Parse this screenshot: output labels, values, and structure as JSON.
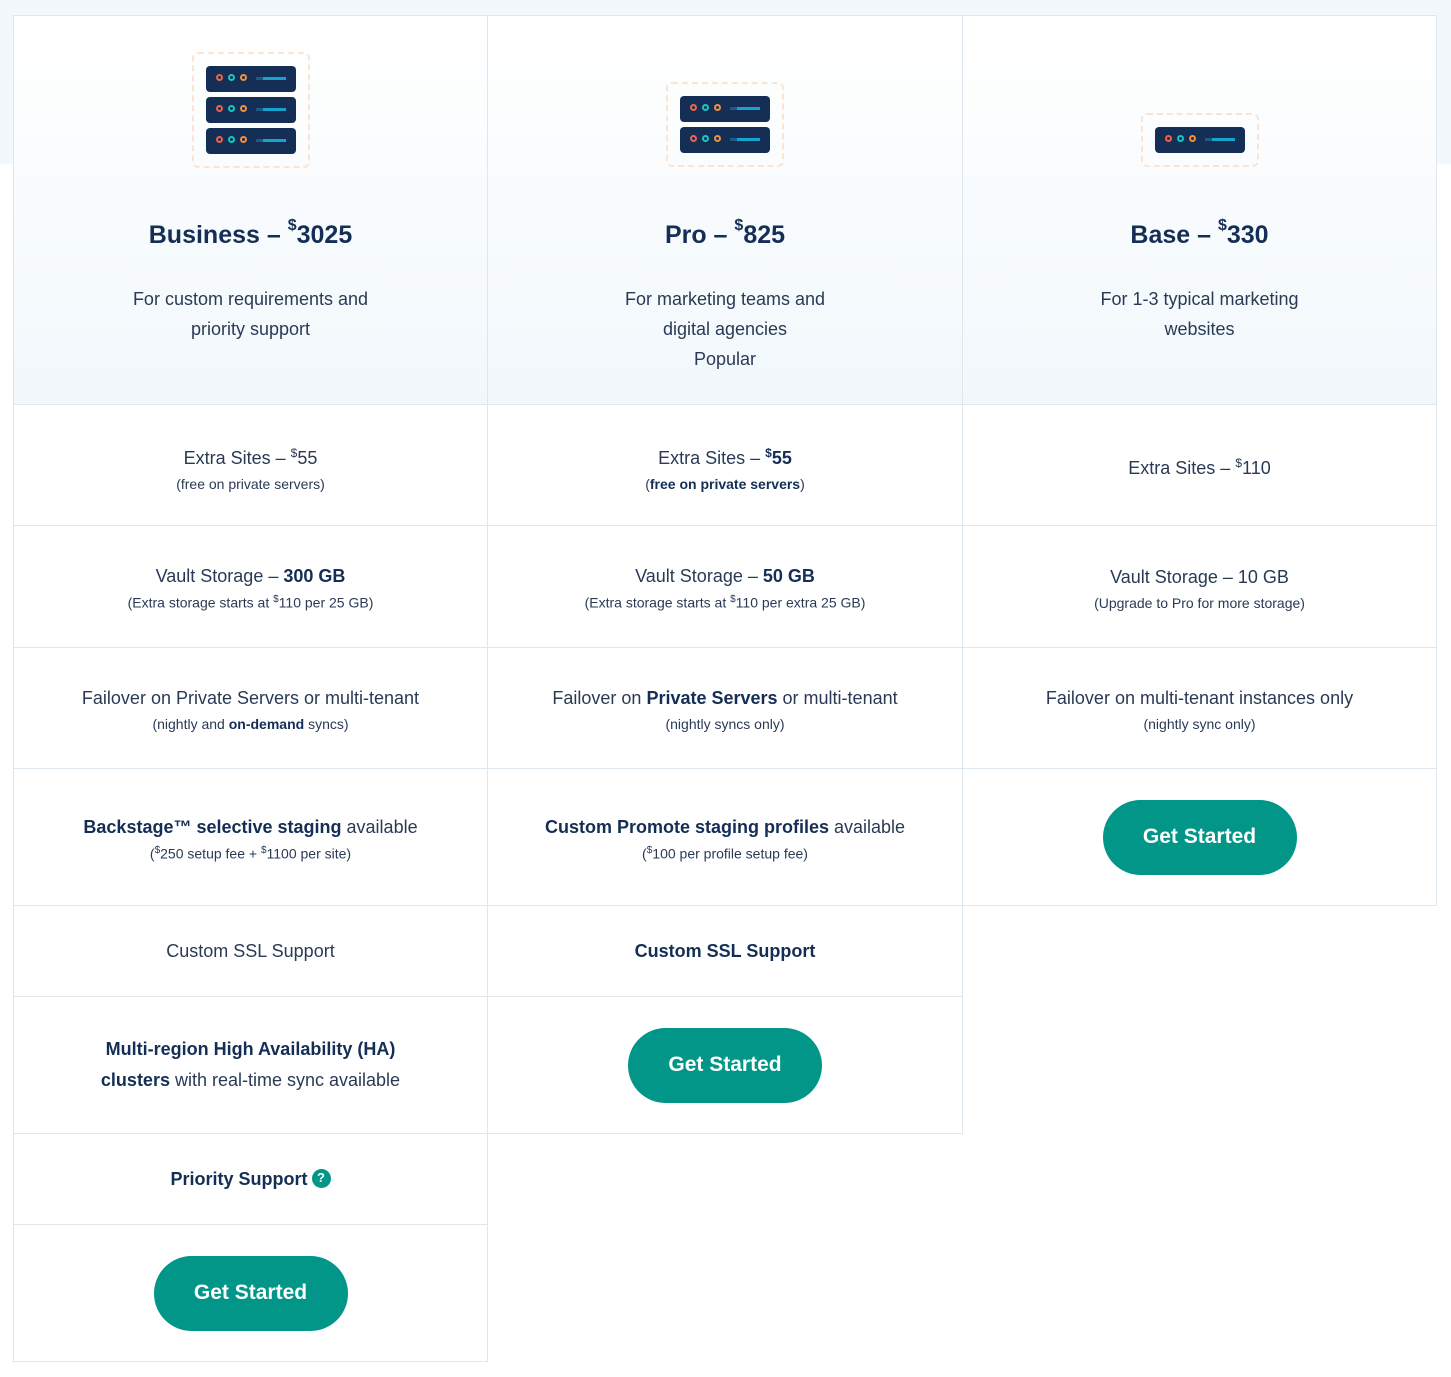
{
  "colors": {
    "accent": "#019688",
    "navy": "#142e55",
    "border": "#dfe7ee",
    "band": "#f2f8fc"
  },
  "plans": {
    "business": {
      "name": "Business –",
      "currency": "$",
      "price": "3025",
      "desc1": "For custom requirements and",
      "desc2": "priority support",
      "extra_sites_label": "Extra Sites – ",
      "extra_sites_price": "55",
      "extra_sites_note": "(free on private servers)",
      "vault_label": "Vault Storage – ",
      "vault_value": "300 GB",
      "vault_note_a": "(Extra storage starts at ",
      "vault_note_price": "110",
      "vault_note_b": " per 25 GB)",
      "failover": "Failover on Private Servers or multi-tenant",
      "failover_note_a": "(nightly and ",
      "failover_note_bold": "on-demand",
      "failover_note_b": " syncs)",
      "staging_bold": "Backstage™ selective staging",
      "staging_rest": " available",
      "staging_note_a": "(",
      "staging_note_p1": "250",
      "staging_note_b": " setup fee + ",
      "staging_note_p2": "1100",
      "staging_note_c": " per site)",
      "ssl": "Custom SSL Support",
      "ha_bold1": "Multi-region High Availability (HA)",
      "ha_bold2": "clusters",
      "ha_rest": " with real-time sync available",
      "priority": "Priority Support",
      "priority_icon": "question-circle-icon",
      "cta": "Get Started"
    },
    "pro": {
      "name": "Pro –",
      "currency": "$",
      "price": "825",
      "desc1": "For marketing teams and",
      "desc2": "digital agencies",
      "badge": "Popular",
      "extra_sites_label": "Extra Sites – ",
      "extra_sites_price": "55",
      "extra_sites_note_bold": "free on private servers",
      "vault_label": "Vault Storage – ",
      "vault_value": "50 GB",
      "vault_note_a": "(Extra storage starts at ",
      "vault_note_price": "110",
      "vault_note_b": " per extra 25 GB)",
      "failover_a": "Failover on ",
      "failover_bold": "Private Servers",
      "failover_b": " or multi-tenant",
      "failover_note": "(nightly syncs only)",
      "staging_bold": "Custom Promote staging profiles",
      "staging_rest": " available",
      "staging_note_a": "(",
      "staging_note_p1": "100",
      "staging_note_b": " per profile setup fee)",
      "ssl": "Custom SSL Support",
      "cta": "Get Started"
    },
    "base": {
      "name": "Base –",
      "currency": "$",
      "price": "330",
      "desc1": "For 1-3 typical marketing",
      "desc2": "websites",
      "extra_sites_label": "Extra Sites – ",
      "extra_sites_price": "110",
      "vault": "Vault Storage – 10 GB",
      "vault_note": "(Upgrade to Pro for more storage)",
      "failover": "Failover on multi-tenant instances only",
      "failover_note": "(nightly sync only)",
      "cta": "Get Started"
    }
  }
}
